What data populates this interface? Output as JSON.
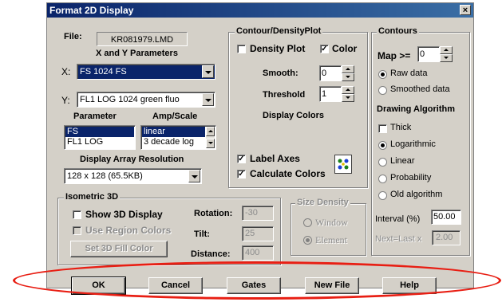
{
  "window": {
    "title": "Format 2D Display",
    "close_glyph": "×"
  },
  "file": {
    "label": "File:",
    "value": "KR081979.LMD"
  },
  "xy": {
    "heading": "X and Y Parameters",
    "x_label": "X:",
    "x_value": "FS 1024 FS",
    "y_label": "Y:",
    "y_value": "FL1 LOG 1024  green fluo"
  },
  "parameter": {
    "heading": "Parameter",
    "items": [
      "FS",
      "FL1 LOG"
    ]
  },
  "amp": {
    "heading": "Amp/Scale",
    "items": [
      "linear",
      "3 decade log"
    ]
  },
  "resolution": {
    "heading": "Display Array Resolution",
    "value": "128 x 128 (65.5KB)"
  },
  "contour_density": {
    "title": "Contour/DensityPlot",
    "density_plot_label": "Density Plot",
    "density_plot_checked": false,
    "color_label": "Color",
    "color_checked": true,
    "smooth_label": "Smooth:",
    "smooth_value": "0",
    "threshold_label": "Threshold",
    "threshold_value": "1",
    "display_colors_label": "Display Colors",
    "label_axes_label": "Label Axes",
    "label_axes_checked": true,
    "calculate_colors_label": "Calculate Colors",
    "calculate_colors_checked": true,
    "check_glyph": "✓"
  },
  "contours": {
    "title": "Contours",
    "map_label": "Map >=",
    "map_value": "0",
    "raw_data_label": "Raw data",
    "smoothed_data_label": "Smoothed data",
    "selected_source": "raw",
    "algorithm_heading": "Drawing Algorithm",
    "thick_label": "Thick",
    "algorithms": [
      "Logarithmic",
      "Linear",
      "Probability",
      "Old algorithm"
    ],
    "selected_algorithm": "Logarithmic",
    "interval_label": "Interval (%)",
    "interval_value": "50.00",
    "next_last_label": "Next=Last x",
    "next_last_value": "2.00"
  },
  "isometric": {
    "title": "Isometric 3D",
    "show_3d_label": "Show 3D Display",
    "use_region_colors_label": "Use Region Colors",
    "set_fill_color_label": "Set 3D Fill Color",
    "rotation_label": "Rotation:",
    "rotation_value": "-30",
    "tilt_label": "Tilt:",
    "tilt_value": "25",
    "distance_label": "Distance:",
    "distance_value": "400"
  },
  "size_density": {
    "title": "Size Density",
    "window_label": "Window",
    "element_label": "Element",
    "selected": "Element"
  },
  "buttons": {
    "ok": "OK",
    "cancel": "Cancel",
    "gates": "Gates",
    "new_file": "New File",
    "help": "Help"
  },
  "colors": {
    "title_bar": "#0a246a",
    "selection": "#0a246a",
    "dialog_face": "#d4d0c8",
    "highlight_ellipse": "#e81e13"
  }
}
